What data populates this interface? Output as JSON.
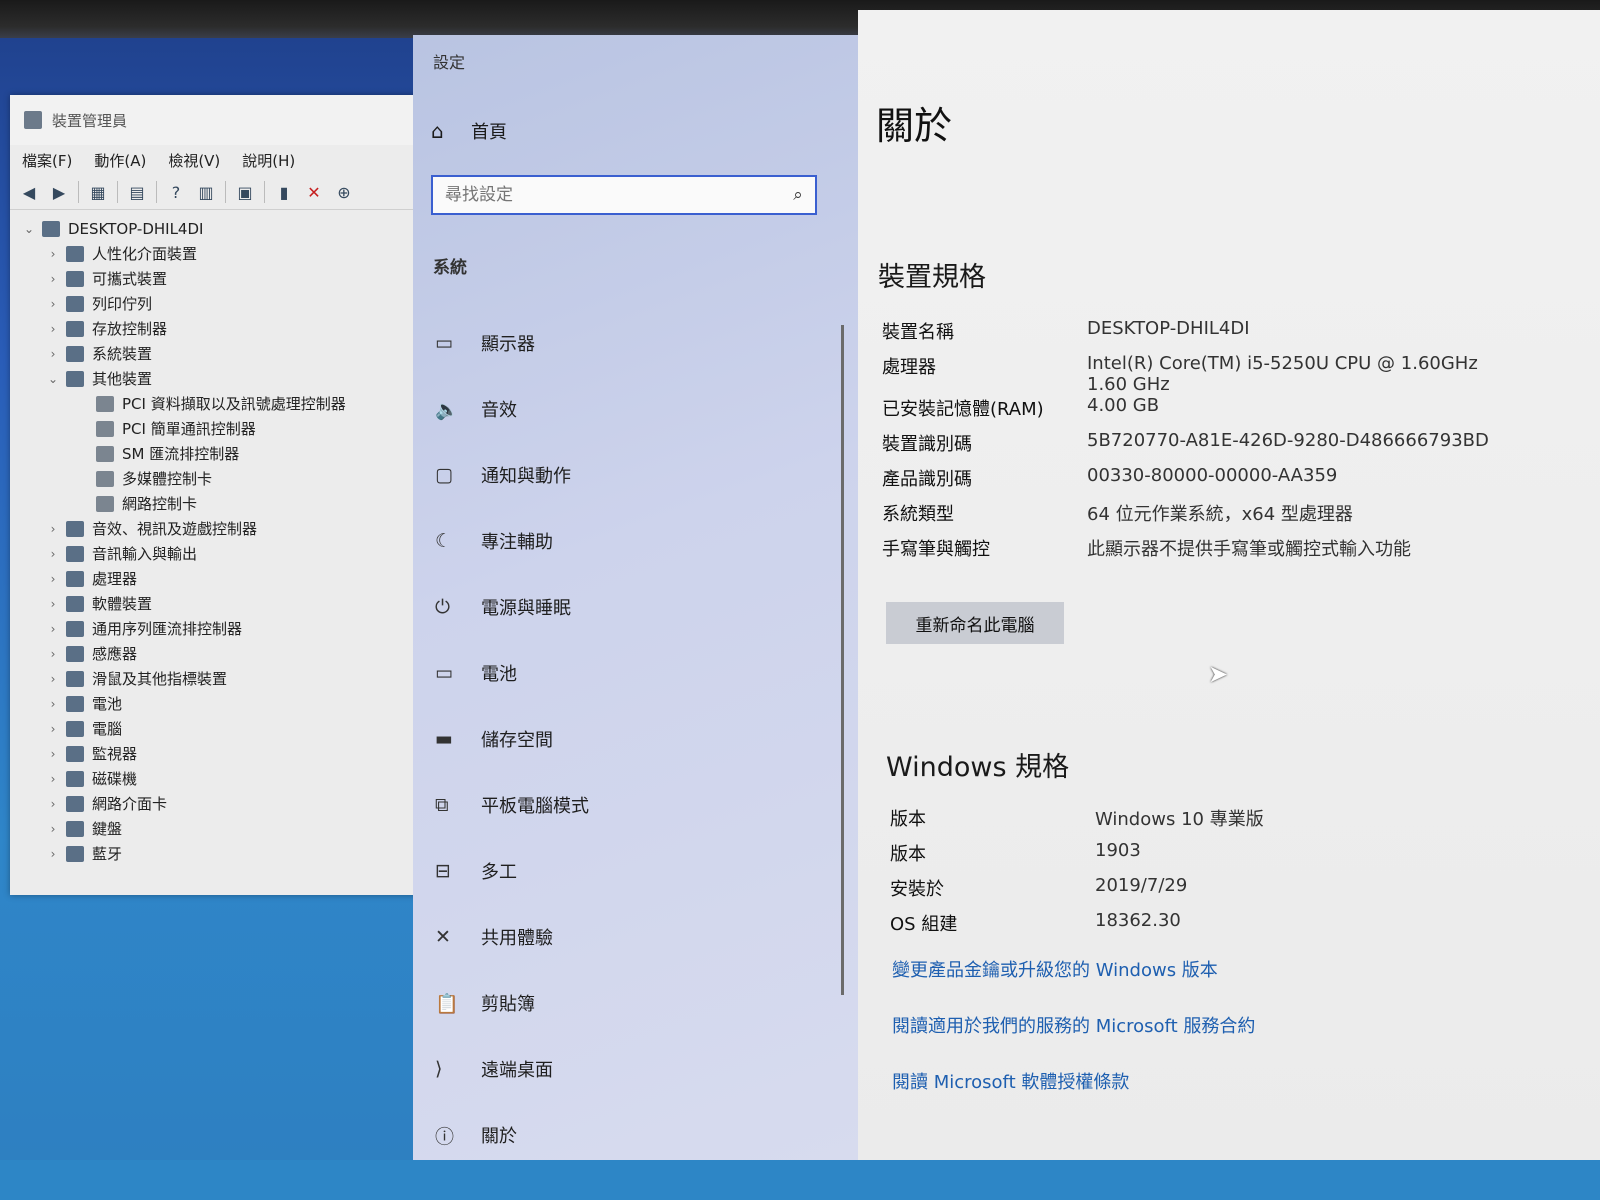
{
  "device_manager": {
    "title": "裝置管理員",
    "menu": [
      "檔案(F)",
      "動作(A)",
      "檢視(V)",
      "說明(H)"
    ],
    "root": "DESKTOP-DHIL4DI",
    "items": [
      {
        "label": "人性化介面裝置",
        "level": 1,
        "expanded": false
      },
      {
        "label": "可攜式裝置",
        "level": 1,
        "expanded": false
      },
      {
        "label": "列印佇列",
        "level": 1,
        "expanded": false
      },
      {
        "label": "存放控制器",
        "level": 1,
        "expanded": false
      },
      {
        "label": "系統裝置",
        "level": 1,
        "expanded": false
      },
      {
        "label": "其他裝置",
        "level": 1,
        "expanded": true
      },
      {
        "label": "PCI 資料擷取以及訊號處理控制器",
        "level": 2
      },
      {
        "label": "PCI 簡單通訊控制器",
        "level": 2
      },
      {
        "label": "SM 匯流排控制器",
        "level": 2
      },
      {
        "label": "多媒體控制卡",
        "level": 2
      },
      {
        "label": "網路控制卡",
        "level": 2
      },
      {
        "label": "音效、視訊及遊戲控制器",
        "level": 1,
        "expanded": false
      },
      {
        "label": "音訊輸入與輸出",
        "level": 1,
        "expanded": false
      },
      {
        "label": "處理器",
        "level": 1,
        "expanded": false
      },
      {
        "label": "軟體裝置",
        "level": 1,
        "expanded": false
      },
      {
        "label": "通用序列匯流排控制器",
        "level": 1,
        "expanded": false
      },
      {
        "label": "感應器",
        "level": 1,
        "expanded": false
      },
      {
        "label": "滑鼠及其他指標裝置",
        "level": 1,
        "expanded": false
      },
      {
        "label": "電池",
        "level": 1,
        "expanded": false
      },
      {
        "label": "電腦",
        "level": 1,
        "expanded": false
      },
      {
        "label": "監視器",
        "level": 1,
        "expanded": false
      },
      {
        "label": "磁碟機",
        "level": 1,
        "expanded": false
      },
      {
        "label": "網路介面卡",
        "level": 1,
        "expanded": false
      },
      {
        "label": "鍵盤",
        "level": 1,
        "expanded": false
      },
      {
        "label": "藍牙",
        "level": 1,
        "expanded": false
      }
    ]
  },
  "settings": {
    "window_title": "設定",
    "home_label": "首頁",
    "search_placeholder": "尋找設定",
    "section": "系統",
    "nav": [
      {
        "label": "顯示器",
        "icon": "monitor-icon",
        "glyph": "▭"
      },
      {
        "label": "音效",
        "icon": "speaker-icon",
        "glyph": "🔈"
      },
      {
        "label": "通知與動作",
        "icon": "notification-icon",
        "glyph": "▢"
      },
      {
        "label": "專注輔助",
        "icon": "moon-icon",
        "glyph": "☾"
      },
      {
        "label": "電源與睡眠",
        "icon": "power-icon",
        "glyph": "⏻"
      },
      {
        "label": "電池",
        "icon": "battery-icon",
        "glyph": "▭"
      },
      {
        "label": "儲存空間",
        "icon": "storage-icon",
        "glyph": "▬"
      },
      {
        "label": "平板電腦模式",
        "icon": "tablet-icon",
        "glyph": "⧉"
      },
      {
        "label": "多工",
        "icon": "multitask-icon",
        "glyph": "⊟"
      },
      {
        "label": "共用體驗",
        "icon": "share-icon",
        "glyph": "✕"
      },
      {
        "label": "剪貼簿",
        "icon": "clipboard-icon",
        "glyph": "📋"
      },
      {
        "label": "遠端桌面",
        "icon": "remote-icon",
        "glyph": "⟩"
      },
      {
        "label": "關於",
        "icon": "info-icon",
        "glyph": "ⓘ"
      }
    ],
    "about": {
      "title": "關於",
      "device_specs_title": "裝置規格",
      "device_specs": [
        {
          "k": "裝置名稱",
          "v": "DESKTOP-DHIL4DI"
        },
        {
          "k": "處理器",
          "v": "Intel(R) Core(TM) i5-5250U CPU @ 1.60GHz\n1.60 GHz"
        },
        {
          "k": "已安裝記憶體(RAM)",
          "v": "4.00 GB"
        },
        {
          "k": "裝置識別碼",
          "v": "5B720770-A81E-426D-9280-D486666793BD"
        },
        {
          "k": "產品識別碼",
          "v": "00330-80000-00000-AA359"
        },
        {
          "k": "系統類型",
          "v": "64 位元作業系統，x64 型處理器"
        },
        {
          "k": "手寫筆與觸控",
          "v": "此顯示器不提供手寫筆或觸控式輸入功能"
        }
      ],
      "rename_button": "重新命名此電腦",
      "windows_specs_title": "Windows 規格",
      "windows_specs": [
        {
          "k": "版本",
          "v": "Windows 10 專業版"
        },
        {
          "k": "版本",
          "v": "1903"
        },
        {
          "k": "安裝於",
          "v": "2019/7/29"
        },
        {
          "k": "OS 組建",
          "v": "18362.30"
        }
      ],
      "links": [
        "變更產品金鑰或升級您的 Windows 版本",
        "閱讀適用於我們的服務的 Microsoft 服務合約",
        "閱讀 Microsoft 軟體授權條款"
      ]
    }
  }
}
